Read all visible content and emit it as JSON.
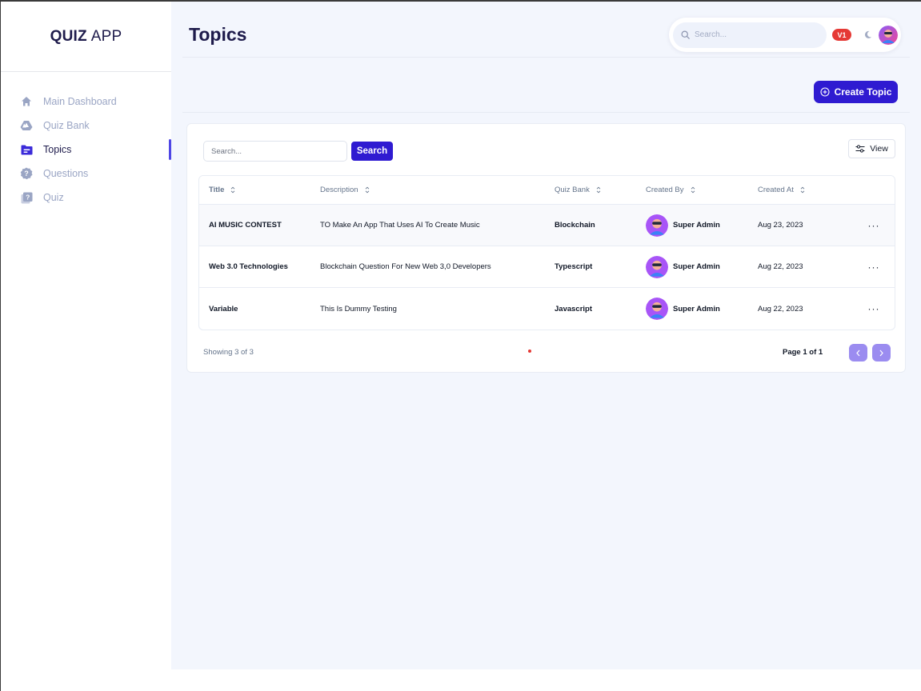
{
  "brand": {
    "bold": "QUIZ",
    "light": "APP"
  },
  "sidebar": {
    "items": [
      {
        "label": "Main Dashboard",
        "icon": "home-icon",
        "active": false
      },
      {
        "label": "Quiz Bank",
        "icon": "drive-icon",
        "active": false
      },
      {
        "label": "Topics",
        "icon": "folder-icon",
        "active": true
      },
      {
        "label": "Questions",
        "icon": "help-badge-icon",
        "active": false
      },
      {
        "label": "Quiz",
        "icon": "quiz-icon",
        "active": false
      }
    ]
  },
  "header": {
    "title": "Topics",
    "search_placeholder": "Search...",
    "version_badge": "V1",
    "theme_icon": "moon-icon"
  },
  "actions": {
    "create_label": "Create Topic",
    "create_icon": "plus-circle-icon"
  },
  "card": {
    "search_placeholder": "Search...",
    "search_button": "Search",
    "view_button": "View"
  },
  "table": {
    "headers": [
      "Title",
      "Description",
      "Quiz Bank",
      "Created By",
      "Created At"
    ],
    "rows": [
      {
        "title": "AI MUSIC CONTEST",
        "description": "TO Make An App That Uses AI To Create Music",
        "quiz_bank": "Blockchain",
        "created_by": "Super Admin",
        "created_at": "Aug 23, 2023",
        "action": "···"
      },
      {
        "title": "Web 3.0 Technologies",
        "description": "Blockchain Question For New Web 3,0 Developers",
        "quiz_bank": "Typescript",
        "created_by": "Super Admin",
        "created_at": "Aug 22, 2023",
        "action": "···"
      },
      {
        "title": "Variable",
        "description": "This Is Dummy Testing",
        "quiz_bank": "Javascript",
        "created_by": "Super Admin",
        "created_at": "Aug 22, 2023",
        "action": "···"
      }
    ]
  },
  "pagination": {
    "showing": "Showing 3 of 3",
    "page": "Page 1 of 1"
  },
  "colors": {
    "accent": "#2f1bd1",
    "sidebar_active_bar": "#4f46e5",
    "badge": "#e53935",
    "page_bg": "#f3f6fd",
    "pager": "#9b8cf0"
  }
}
